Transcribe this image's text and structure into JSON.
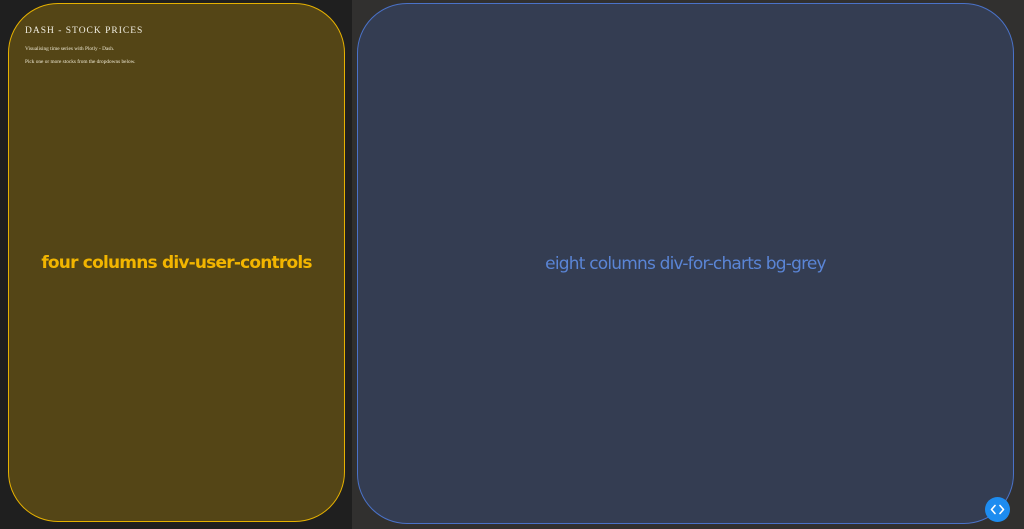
{
  "controls": {
    "title": "DASH - STOCK PRICES",
    "description_1": "Visualising time series with Plotly - Dash.",
    "description_2": "Pick one or more stocks from the dropdowns below.",
    "overlay_label": "four columns div-user-controls"
  },
  "charts": {
    "overlay_label": "eight columns div-for-charts bg-grey"
  },
  "code_toggle": {
    "icon": "code-brackets-icon"
  },
  "colors": {
    "controls_border": "#e6b100",
    "controls_fill": "#544516",
    "controls_label": "#f2b500",
    "charts_border": "#4a72c8",
    "charts_fill": "#343d52",
    "charts_label": "#5a85d6",
    "toggle_button": "#1d8cf0"
  }
}
